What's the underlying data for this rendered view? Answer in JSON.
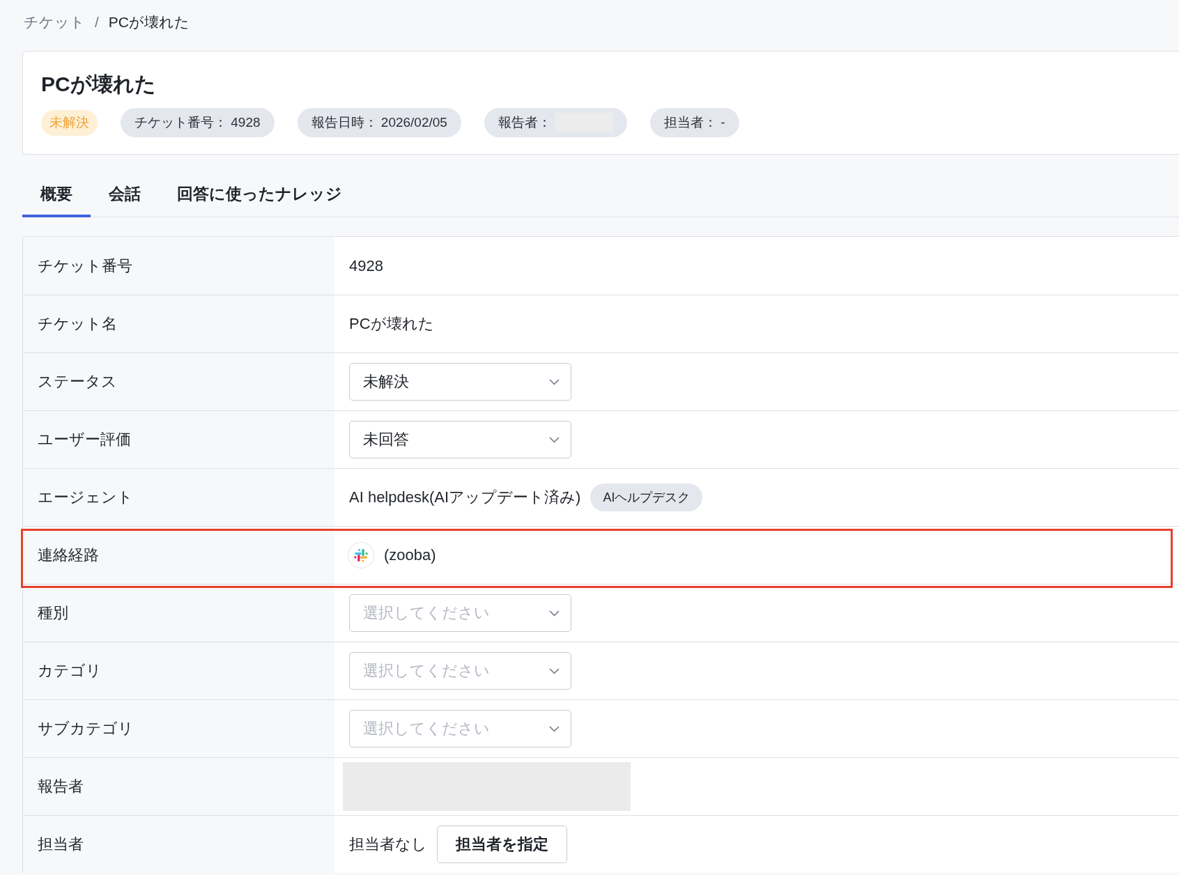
{
  "breadcrumb": {
    "items": [
      {
        "label": "チケット",
        "kind": "link"
      },
      {
        "label": "PCが壊れた",
        "kind": "current"
      }
    ],
    "separator": "/"
  },
  "ticket": {
    "title": "PCが壊れた",
    "tags": [
      {
        "kind": "status",
        "label": "未解決"
      },
      {
        "kind": "info",
        "label": "チケット番号： 4928"
      },
      {
        "kind": "info",
        "label": "報告日時： 2026/02/05"
      },
      {
        "kind": "redacted",
        "label": "報告者："
      },
      {
        "kind": "info",
        "label": "担当者： -"
      }
    ]
  },
  "tabs": [
    {
      "label": "概要",
      "selected": true
    },
    {
      "label": "会話",
      "selected": false
    },
    {
      "label": "回答に使ったナレッジ",
      "selected": false
    }
  ],
  "details": [
    {
      "kind": "text",
      "label": "チケット番号",
      "value": "4928",
      "highlighted": false
    },
    {
      "kind": "text",
      "label": "チケット名",
      "value": "PCが壊れた",
      "highlighted": false
    },
    {
      "kind": "select",
      "label": "ステータス",
      "value": "未解決",
      "highlighted": false
    },
    {
      "kind": "select",
      "label": "ユーザー評価",
      "value": "未回答",
      "highlighted": false
    },
    {
      "kind": "agent",
      "label": "エージェント",
      "value": "AI helpdesk(AIアップデート済み)",
      "badge": "AIヘルプデスク",
      "highlighted": false
    },
    {
      "kind": "channel",
      "label": "連絡経路",
      "value": "(zooba)",
      "highlighted": true
    },
    {
      "kind": "select",
      "label": "種別",
      "placeholder": "選択してください",
      "highlighted": false
    },
    {
      "kind": "select",
      "label": "カテゴリ",
      "placeholder": "選択してください",
      "highlighted": false
    },
    {
      "kind": "select",
      "label": "サブカテゴリ",
      "placeholder": "選択してください",
      "highlighted": false
    },
    {
      "kind": "redacted",
      "label": "報告者",
      "highlighted": false
    },
    {
      "kind": "assignee",
      "label": "担当者",
      "value": "担当者なし",
      "button": "担当者を指定",
      "highlighted": false
    }
  ]
}
